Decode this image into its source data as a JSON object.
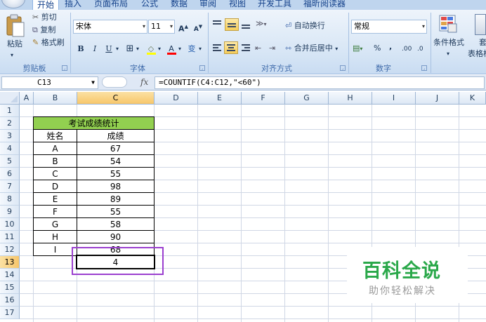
{
  "ribbon": {
    "tabs": [
      "开始",
      "插入",
      "页面布局",
      "公式",
      "数据",
      "审阅",
      "视图",
      "开发工具",
      "福昕阅读器"
    ],
    "clipboard": {
      "paste_label": "粘贴",
      "cut_label": "剪切",
      "copy_label": "复制",
      "format_painter_label": "格式刷",
      "group_label": "剪贴板"
    },
    "font": {
      "font_name": "宋体",
      "font_size": "11",
      "grow_label": "A",
      "shrink_label": "A",
      "bold_label": "B",
      "italic_label": "I",
      "underline_label": "U",
      "border_label": "⊞",
      "fill_label": "◇",
      "fontcolor_label": "A",
      "phonetic_label": "变",
      "group_label": "字体"
    },
    "alignment": {
      "wrap_label": "自动换行",
      "merge_label": "合并后居中",
      "group_label": "对齐方式"
    },
    "number": {
      "format_value": "常规",
      "percent_label": "%",
      "comma_label": ",",
      "inc_decimal_label": ".00",
      "dec_decimal_label": ".0",
      "group_label": "数字"
    },
    "styles": {
      "conditional_label": "条件格式",
      "table_label": "套用",
      "table_label_2": "表格格"
    },
    "accent_color": "#f6cd59"
  },
  "formula_bar": {
    "cell_name": "C13",
    "fx_label": "fx",
    "formula": "=COUNTIF(C4:C12,\"<60\")"
  },
  "sheet": {
    "columns": [
      "A",
      "B",
      "C",
      "D",
      "E",
      "F",
      "G",
      "H",
      "I",
      "J",
      "K"
    ],
    "rows": [
      "1",
      "2",
      "3",
      "4",
      "5",
      "6",
      "7",
      "8",
      "9",
      "10",
      "11",
      "12",
      "13",
      "14",
      "15",
      "16",
      "17"
    ],
    "table_title": "考试成绩统计",
    "header_name": "姓名",
    "header_score": "成绩",
    "names": [
      "A",
      "B",
      "C",
      "D",
      "E",
      "F",
      "G",
      "H",
      "I"
    ],
    "scores": [
      "67",
      "54",
      "55",
      "98",
      "89",
      "55",
      "58",
      "90",
      "68"
    ],
    "result": "4",
    "title_fill_color": "#92d050",
    "highlight_color": "#9b3fcf"
  },
  "watermark": {
    "title": "百科全说",
    "subtitle": "助你轻松解决"
  }
}
